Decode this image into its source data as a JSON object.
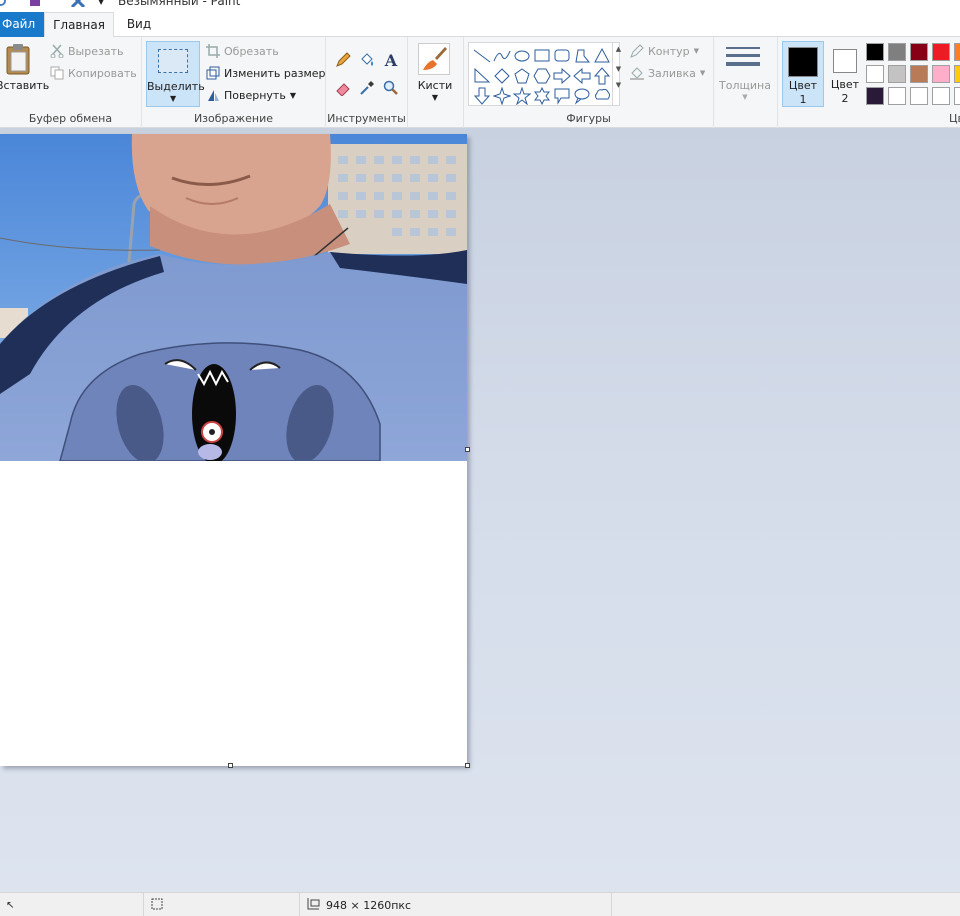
{
  "window": {
    "title": "Безымянный - Paint"
  },
  "tabs": [
    {
      "label": "Файл"
    },
    {
      "label": "Главная"
    },
    {
      "label": "Вид"
    }
  ],
  "clipboard": {
    "paste": "Вставить",
    "cut": "Вырезать",
    "copy": "Копировать",
    "group": "Буфер обмена"
  },
  "image": {
    "select": "Выделить",
    "crop": "Обрезать",
    "resize": "Изменить размер",
    "rotate": "Повернуть",
    "group": "Изображение"
  },
  "tools": {
    "group": "Инструменты",
    "text_glyph": "A"
  },
  "brushes": {
    "label": "Кисти"
  },
  "shapes": {
    "group": "Фигуры",
    "outline": "Контур",
    "fill": "Заливка"
  },
  "thickness": {
    "label": "Толщина"
  },
  "colors": {
    "color1_label_a": "Цвет",
    "color1_label_b": "1",
    "color2_label_a": "Цвет",
    "color2_label_b": "2",
    "color1_value": "#000000",
    "color2_value": "#ffffff",
    "group_partial": "Цв",
    "palette_row1": [
      "#000000",
      "#7f7f7f",
      "#880015",
      "#ed1c24",
      "#ff7f27"
    ],
    "palette_row2": [
      "#ffffff",
      "#c3c3c3",
      "#b97a57",
      "#ffaec9",
      "#ffc90e"
    ],
    "palette_row3": [
      "#2a1a3a",
      "#ffffff",
      "#ffffff",
      "#ffffff",
      "#ffffff"
    ]
  },
  "status": {
    "image_size": "948 × 1260пкс"
  }
}
